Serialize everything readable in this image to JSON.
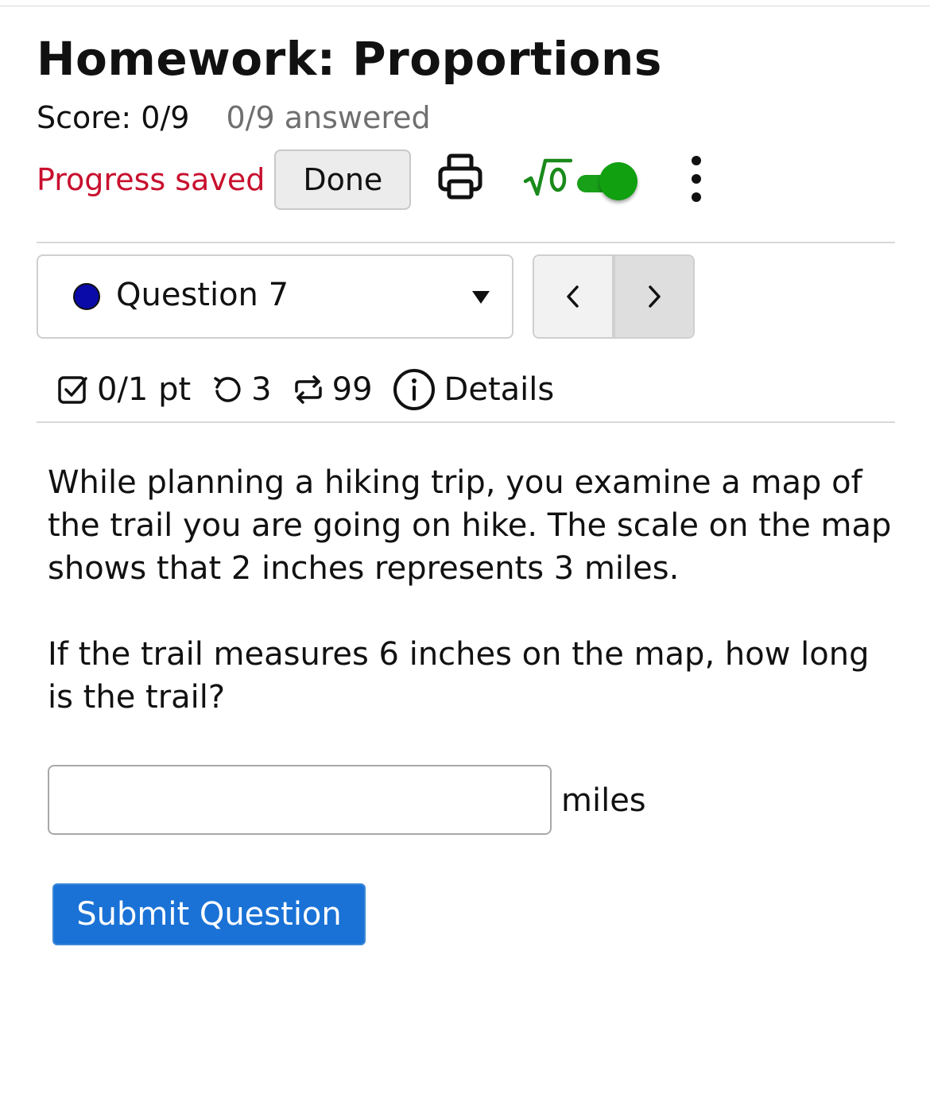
{
  "header": {
    "title": "Homework: Proportions",
    "score": "Score: 0/9",
    "answered": "0/9 answered"
  },
  "toolbar": {
    "progress_label": "Progress saved",
    "done_label": "Done",
    "icons": [
      "print-icon",
      "math-sqrt-icon",
      "toggle-switch",
      "more-vertical-icon"
    ],
    "toggle_on": true,
    "accent_green": "#19a019"
  },
  "question_nav": {
    "selected": "Question 7",
    "status_color": "#0a0aa8",
    "prev_icon": "chevron-left-icon",
    "next_icon": "chevron-right-icon"
  },
  "meta": {
    "points": "0/1 pt",
    "retries": "3",
    "attempts": "99",
    "details_label": "Details"
  },
  "question": {
    "paragraph1": "While planning a hiking trip, you examine a map of the trail you are going on hike. The scale on the map shows that 2 inches represents 3 miles.",
    "paragraph2": "If the trail measures 6 inches on the map, how long is the trail?",
    "answer_value": "",
    "unit": "miles"
  },
  "submit_label": "Submit Question",
  "colors": {
    "progress_red": "#c8102e",
    "submit_blue": "#1a72d6"
  }
}
